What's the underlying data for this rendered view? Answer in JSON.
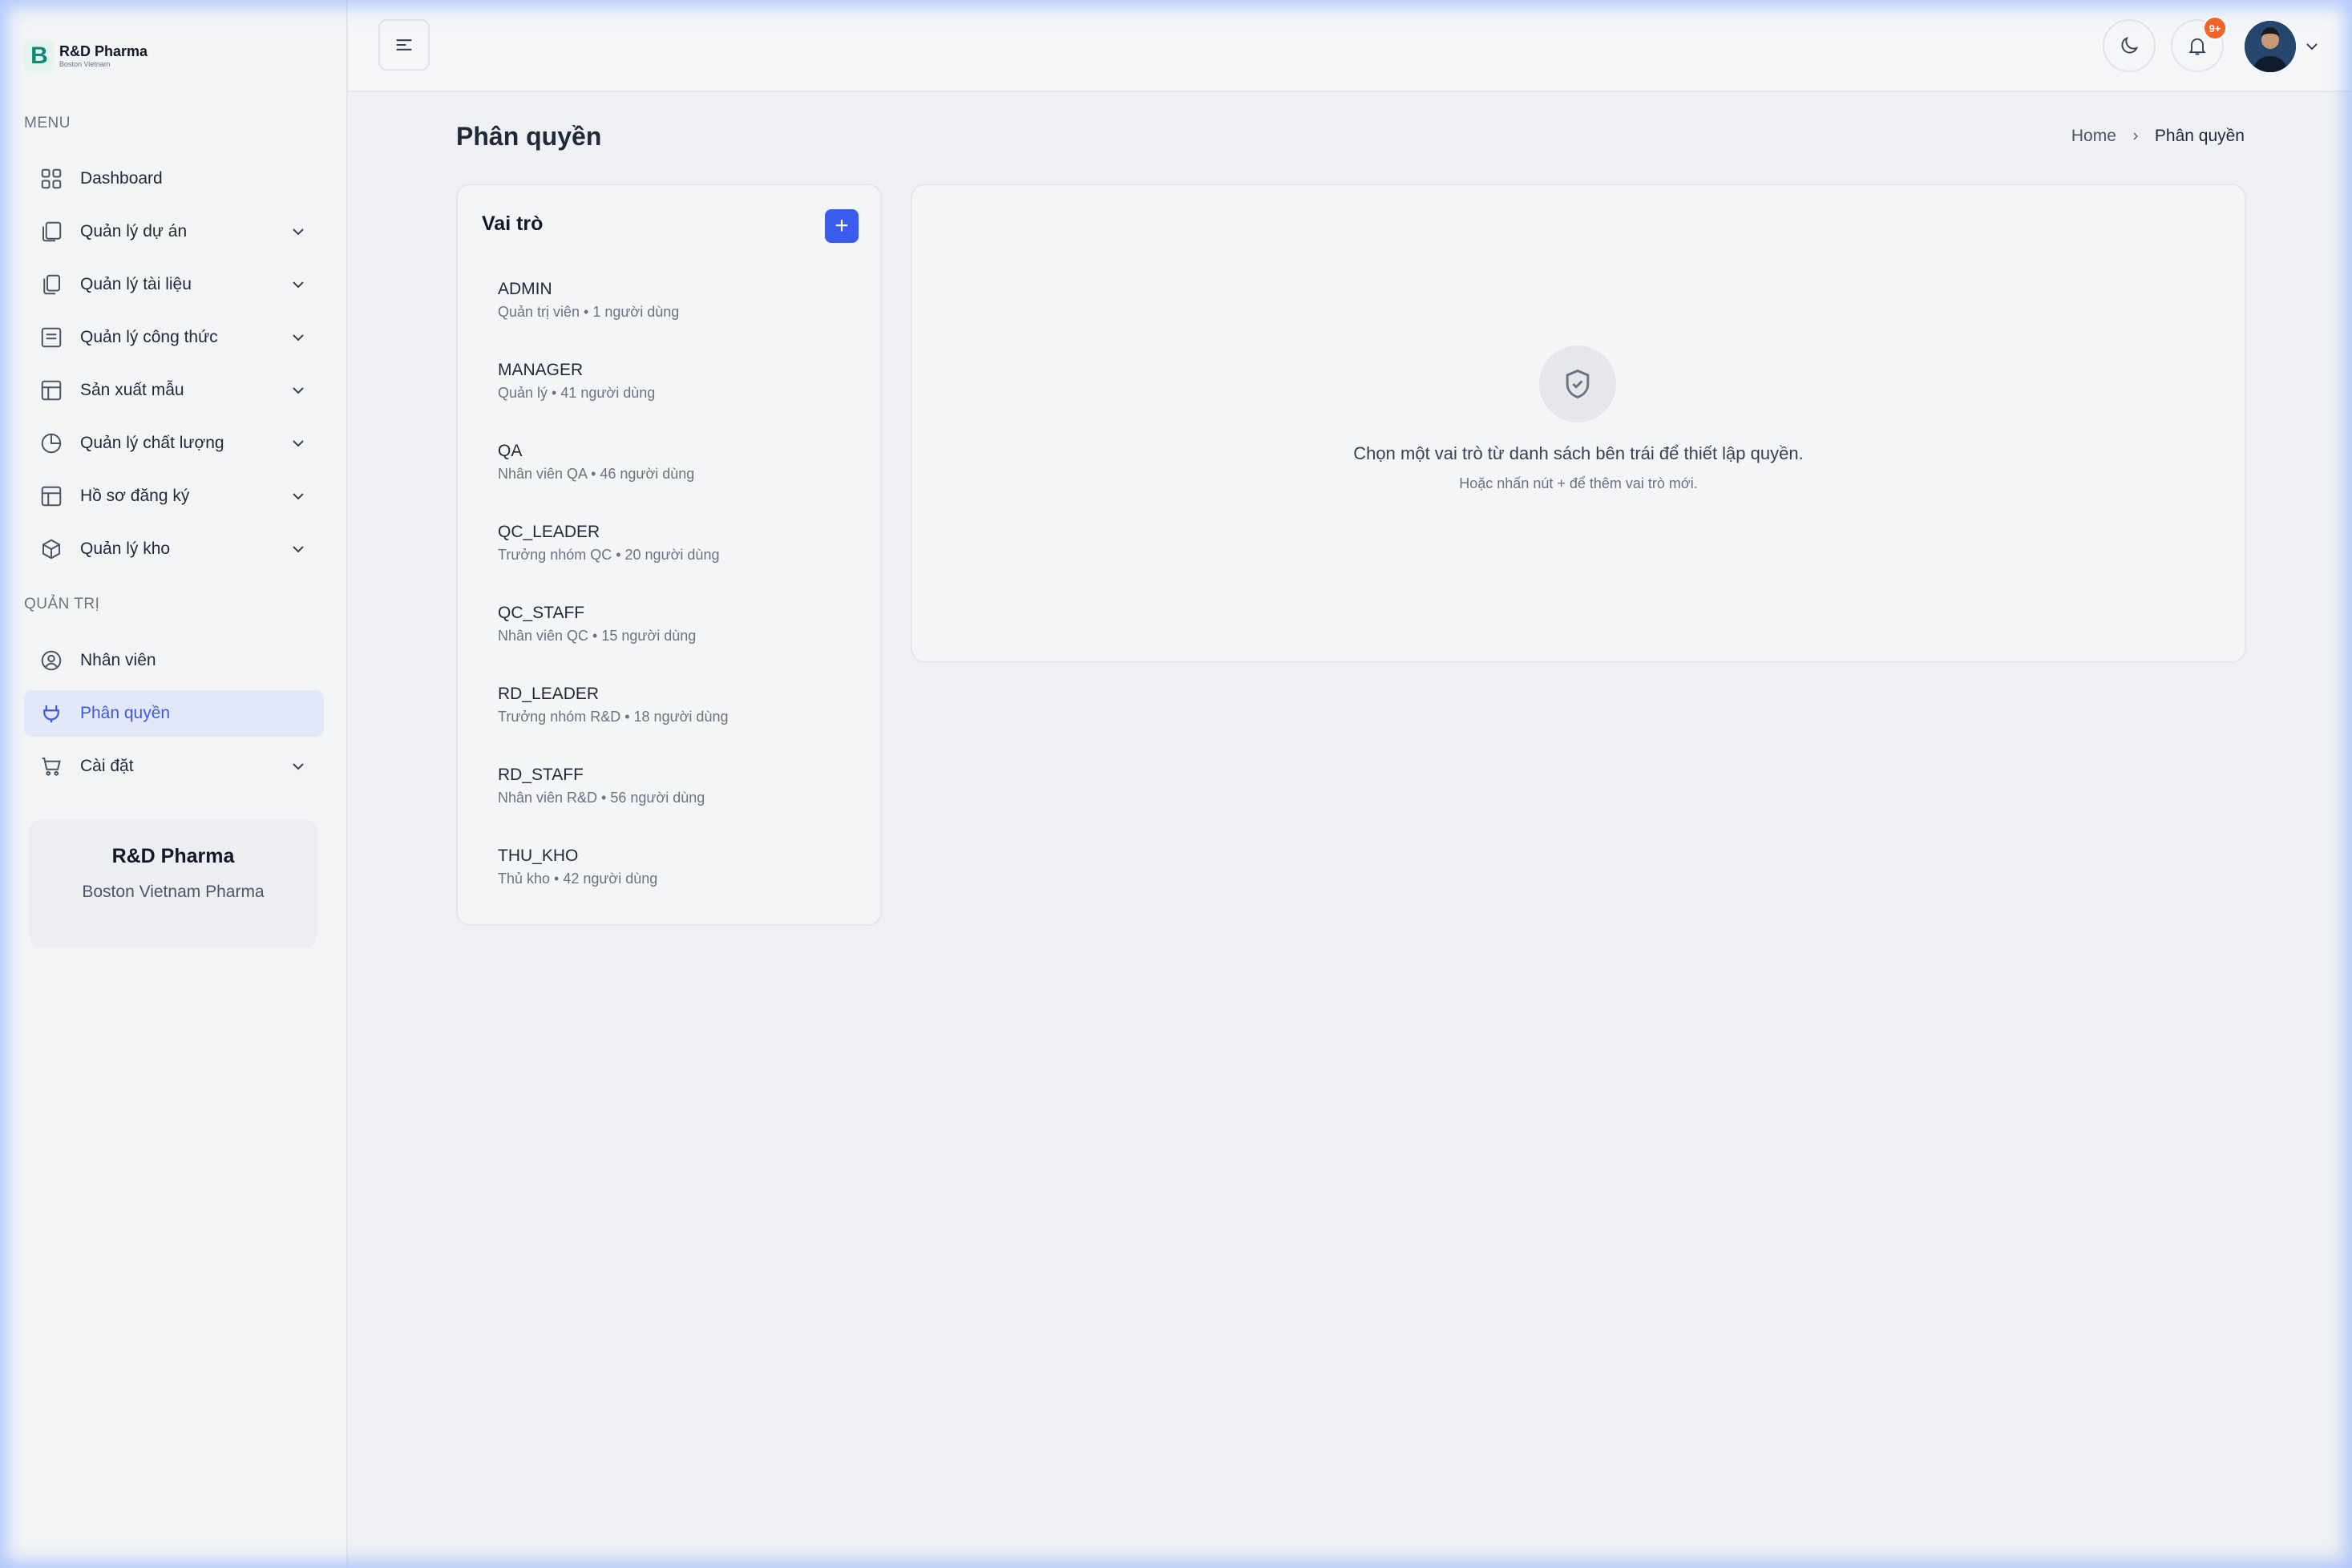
{
  "brand": {
    "logo_letter": "B",
    "name": "R&D Pharma",
    "subtitle": "Boston Vietnam"
  },
  "sidebar": {
    "menu_label": "MENU",
    "menu_items": [
      {
        "label": "Dashboard",
        "icon": "grid-icon",
        "has_submenu": false
      },
      {
        "label": "Quản lý dự án",
        "icon": "copy-icon",
        "has_submenu": true
      },
      {
        "label": "Quản lý tài liệu",
        "icon": "document-copy-icon",
        "has_submenu": true
      },
      {
        "label": "Quản lý công thức",
        "icon": "list-icon",
        "has_submenu": true
      },
      {
        "label": "Sản xuất mẫu",
        "icon": "table-icon",
        "has_submenu": true
      },
      {
        "label": "Quản lý chất lượng",
        "icon": "pie-chart-icon",
        "has_submenu": true
      },
      {
        "label": "Hồ sơ đăng ký",
        "icon": "layout-icon",
        "has_submenu": true
      },
      {
        "label": "Quản lý kho",
        "icon": "box-icon",
        "has_submenu": true
      }
    ],
    "admin_label": "QUẢN TRỊ",
    "admin_items": [
      {
        "label": "Nhân viên",
        "icon": "user-circle-icon",
        "has_submenu": false,
        "active": false
      },
      {
        "label": "Phân quyền",
        "icon": "plug-icon",
        "has_submenu": false,
        "active": true
      },
      {
        "label": "Cài đặt",
        "icon": "cart-icon",
        "has_submenu": true,
        "active": false
      }
    ],
    "promo": {
      "title": "R&D Pharma",
      "subtitle": "Boston Vietnam Pharma"
    }
  },
  "header": {
    "notification_badge": "9+",
    "icons": [
      "menu-icon",
      "moon-icon",
      "bell-icon",
      "chevron-down-icon"
    ]
  },
  "page": {
    "title": "Phân quyền",
    "breadcrumb": {
      "home": "Home",
      "current": "Phân quyền"
    }
  },
  "roles": {
    "title": "Vai trò",
    "add_label": "+",
    "items": [
      {
        "code": "ADMIN",
        "desc": "Quản trị viên • 1 người dùng"
      },
      {
        "code": "MANAGER",
        "desc": "Quản lý • 41 người dùng"
      },
      {
        "code": "QA",
        "desc": "Nhân viên QA • 46 người dùng"
      },
      {
        "code": "QC_LEADER",
        "desc": "Trưởng nhóm QC • 20 người dùng"
      },
      {
        "code": "QC_STAFF",
        "desc": "Nhân viên QC • 15 người dùng"
      },
      {
        "code": "RD_LEADER",
        "desc": "Trưởng nhóm R&D • 18 người dùng"
      },
      {
        "code": "RD_STAFF",
        "desc": "Nhân viên R&D • 56 người dùng"
      },
      {
        "code": "THU_KHO",
        "desc": "Thủ kho • 42 người dùng"
      }
    ]
  },
  "empty_state": {
    "icon": "shield-check-icon",
    "message": "Chọn một vai trò từ danh sách bên trái để thiết lập quyền.",
    "hint": "Hoặc nhấn nút + để thêm vai trò mới."
  },
  "colors": {
    "accent": "#3b5bf0",
    "active_bg": "#e3e8f8",
    "badge": "#f0652a",
    "brand": "#0f8a74"
  }
}
